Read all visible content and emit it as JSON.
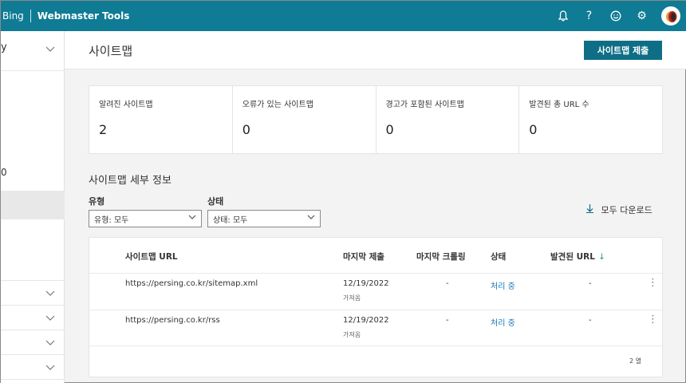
{
  "header": {
    "bing": "Bing",
    "product": "Webmaster Tools",
    "icons": [
      "bell-icon",
      "help-icon",
      "smiley-icon",
      "gear-icon"
    ]
  },
  "sidebar": {
    "top_fragment": "y",
    "mid_fragment": "0"
  },
  "page": {
    "title": "사이트맵",
    "submit_label": "사이트맵 제출"
  },
  "stats": [
    {
      "label": "알려진 사이트맵",
      "value": "2"
    },
    {
      "label": "오류가 있는 사이트맵",
      "value": "0"
    },
    {
      "label": "경고가 포함된 사이트맵",
      "value": "0"
    },
    {
      "label": "발견된 총 URL 수",
      "value": "0"
    }
  ],
  "details": {
    "title": "사이트맵 세부 정보",
    "type_label": "유형",
    "type_value": "유형: 모두",
    "status_label": "상태",
    "status_value": "상태: 모두",
    "download_label": "모두 다운로드"
  },
  "table": {
    "headers": [
      "사이트맵 URL",
      "마지막 제출",
      "마지막 크롤링",
      "상태",
      "발견된 URL"
    ],
    "rows": [
      {
        "url": "https://persing.co.kr/sitemap.xml",
        "submitted": "12/19/2022",
        "submitted_sub": "가져옴",
        "crawled": "-",
        "status": "처리 중",
        "discovered": "-"
      },
      {
        "url": "https://persing.co.kr/rss",
        "submitted": "12/19/2022",
        "submitted_sub": "가져옴",
        "crawled": "-",
        "status": "처리 중",
        "discovered": "-"
      }
    ],
    "row_count": "2 열"
  },
  "colors": {
    "topbar": "#0f7b94",
    "primary_button": "#0e6e86",
    "status_link": "#1576b8",
    "sort_arrow": "#1f9e6b"
  }
}
